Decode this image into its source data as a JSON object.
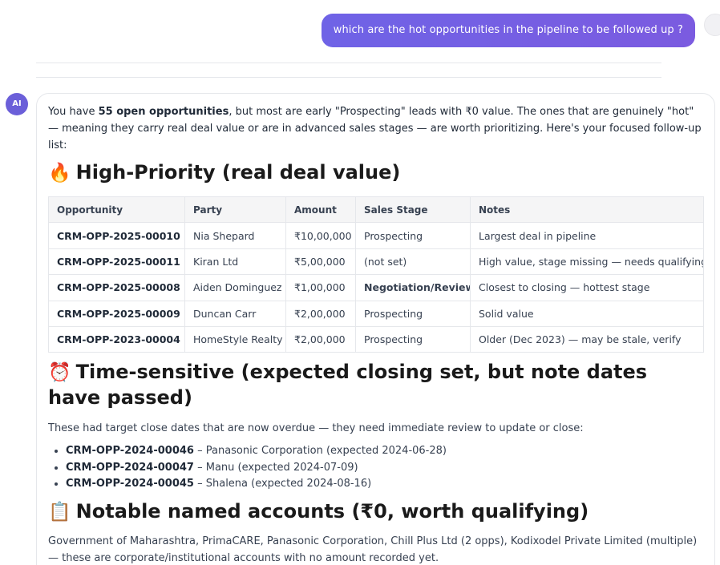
{
  "user_message": {
    "text": "which are the hot opportunities in the pipeline to be followed up ?"
  },
  "assistant": {
    "avatar_label": "AI",
    "intro_pre": "You have ",
    "intro_bold": "55 open opportunities",
    "intro_post": ", but most are early \"Prospecting\" leads with ₹0 value. The ones that are genuinely \"hot\" — meaning they carry real deal value or are in advanced sales stages — are worth prioritizing. Here's your focused follow-up list:",
    "section1": {
      "emoji": "🔥",
      "title": "High-Priority (real deal value)"
    },
    "table": {
      "columns": [
        "Opportunity",
        "Party",
        "Amount",
        "Sales Stage",
        "Notes"
      ],
      "rows": [
        {
          "opportunity": "CRM-OPP-2025-00010",
          "party": "Nia Shepard",
          "amount": "₹10,00,000",
          "stage": "Prospecting",
          "notes": "Largest deal in pipeline"
        },
        {
          "opportunity": "CRM-OPP-2025-00011",
          "party": "Kiran Ltd",
          "amount": "₹5,00,000",
          "stage": "(not set)",
          "notes": "High value, stage missing — needs qualifying"
        },
        {
          "opportunity": "CRM-OPP-2025-00008",
          "party": "Aiden Dominguez",
          "amount": "₹1,00,000",
          "stage": "Negotiation/Review",
          "notes": "Closest to closing — hottest stage"
        },
        {
          "opportunity": "CRM-OPP-2025-00009",
          "party": "Duncan Carr",
          "amount": "₹2,00,000",
          "stage": "Prospecting",
          "notes": "Solid value"
        },
        {
          "opportunity": "CRM-OPP-2023-00004",
          "party": "HomeStyle Realty",
          "amount": "₹2,00,000",
          "stage": "Prospecting",
          "notes": "Older (Dec 2023) — may be stale, verify"
        }
      ]
    },
    "section2": {
      "emoji": "⏰",
      "title": "Time-sensitive (expected closing set, but note dates have passed)",
      "paragraph": "These had target close dates that are now overdue — they need immediate review to update or close:",
      "items": [
        {
          "id": "CRM-OPP-2024-00046",
          "text": " – Panasonic Corporation (expected 2024-06-28)"
        },
        {
          "id": "CRM-OPP-2024-00047",
          "text": " – Manu (expected 2024-07-09)"
        },
        {
          "id": "CRM-OPP-2024-00045",
          "text": " – Shalena (expected 2024-08-16)"
        }
      ]
    },
    "section3": {
      "emoji": "📋",
      "title": "Notable named accounts (₹0, worth qualifying)",
      "paragraph": "Government of Maharashtra, PrimaCARE, Panasonic Corporation, Chill Plus Ltd (2 opps), Kodixodel Private Limited (multiple) — these are corporate/institutional accounts with no amount recorded yet."
    }
  }
}
